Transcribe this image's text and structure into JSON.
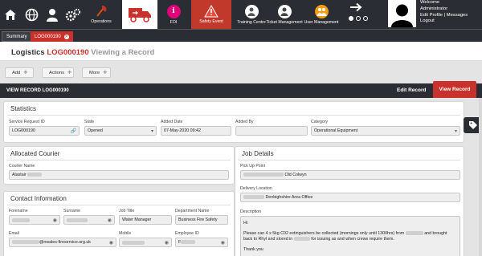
{
  "nav": {
    "operations": "Operations",
    "foi": "FOI",
    "safety_event": "Safety Event",
    "training_centre": "Training Centre",
    "ticket_management": "Ticket Management",
    "user_management": "User Management"
  },
  "user": {
    "welcome": "Welcome",
    "name": "Administrator",
    "edit_profile": "Edit Profile | Messages",
    "logout": "Logout"
  },
  "tabs": {
    "summary": "Summary",
    "record": "LOG000190"
  },
  "title": {
    "module": "Logistics",
    "record_id": "LOG000190",
    "mode": "Viewing a Record"
  },
  "toolbar": {
    "add": "Add",
    "actions": "Actions",
    "more": "More"
  },
  "record_bar": {
    "title": "VIEW RECORD LOG000190",
    "edit": "Edit Record",
    "view": "View Record"
  },
  "statistics": {
    "heading": "Statistics",
    "fields": {
      "service_request_id": {
        "label": "Service Request ID",
        "value": "LOG000190"
      },
      "state": {
        "label": "State",
        "value": "Opened"
      },
      "added_date": {
        "label": "Added Date",
        "value": "07-May-2020 09:42"
      },
      "added_by": {
        "label": "Added By",
        "value": ""
      },
      "category": {
        "label": "Category",
        "value": "Operational Equipment"
      }
    }
  },
  "courier": {
    "heading": "Allocated Courier",
    "name_label": "Courier Name",
    "name_value": "Alastair"
  },
  "contact": {
    "heading": "Contact Information",
    "forename_label": "Forename",
    "surname_label": "Surname",
    "job_title_label": "Job Title",
    "job_title_value": "Water Manager",
    "department_label": "Department Name",
    "department_value": "Business Fire Safety",
    "email_label": "Email",
    "email_value": "@nwales-fireservice.org.uk",
    "mobile_label": "Mobile",
    "employee_id_label": "Employee ID",
    "employee_id_value": "F"
  },
  "job": {
    "heading": "Job Details",
    "pickup_label": "Pick Up Point",
    "pickup_value": "Old Colwyn",
    "delivery_label": "Delivery Location",
    "delivery_value": "Denbighshire Area Office",
    "description_label": "Description",
    "desc_hi": "Hi",
    "desc_line1a": "Please can 4 x 5kg C02 extinguishers be collected (mornings only until 1300hrs) from",
    "desc_line1b": "and brought",
    "desc_line2a": "back to Rhyl and stored in",
    "desc_line2b": "for issuing as and when crews require them.",
    "desc_thanks": "Thank you"
  },
  "colors": {
    "accent": "#c9322c",
    "nav_bg": "#2a2d33",
    "pink": "#e0007a",
    "orange": "#f39c12",
    "red_warning": "#c0392b"
  }
}
